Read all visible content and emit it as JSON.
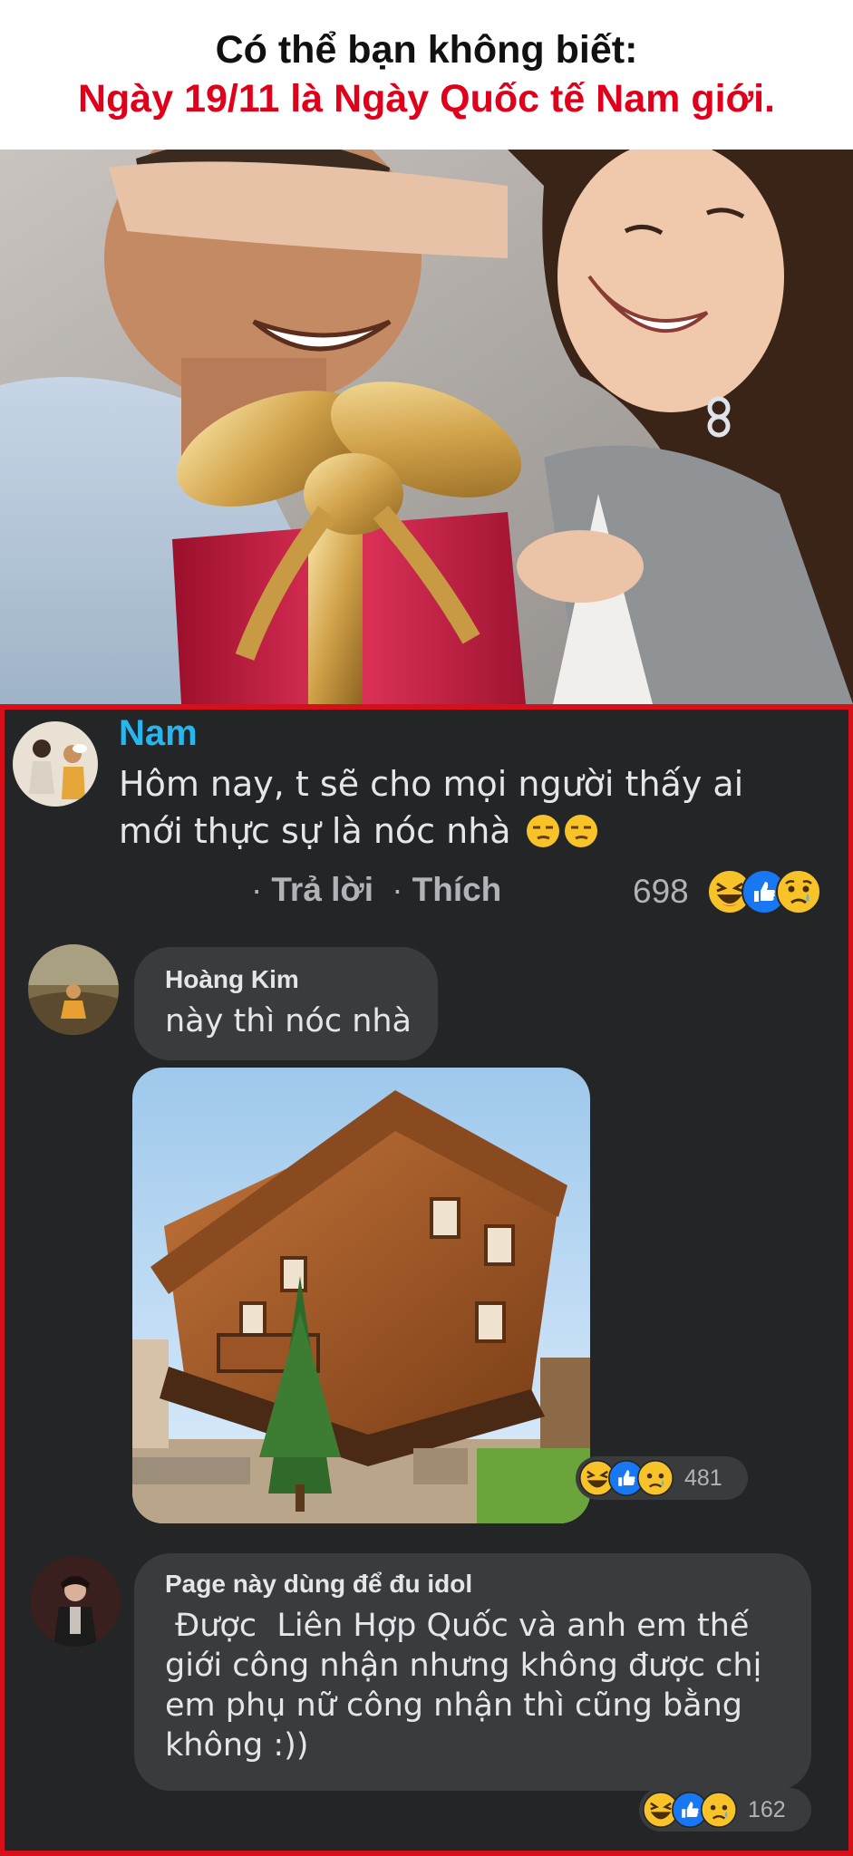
{
  "header": {
    "line1": "Có thể bạn không biết:",
    "line2": "Ngày 19/11 là Ngày Quốc tế Nam giới."
  },
  "hero": {
    "image": "photo-woman-covering-mans-eyes-with-gift"
  },
  "comments": [
    {
      "author": "Nam",
      "text_line1": "Hôm nay, t sẽ cho mọi người thấy ai",
      "text_line2": "mới thực sự là nóc nhà",
      "emojis": [
        "unamused-face",
        "unamused-face"
      ],
      "actions": [
        "Trả lời",
        "Thích"
      ],
      "reaction_count": "698",
      "reactions": [
        "haha",
        "like",
        "sad"
      ]
    },
    {
      "author": "Hoàng Kim",
      "text": "này thì nóc nhà",
      "image": "photo-upside-down-house",
      "reaction_count": "481",
      "reactions": [
        "haha",
        "like",
        "sad"
      ]
    },
    {
      "author": "Page này dùng để đu idol",
      "text_lines": [
        " Được  Liên Hợp Quốc và anh em thế",
        "giới công nhận nhưng không được chị",
        "em phụ nữ công nhận thì cũng bằng",
        "không :))"
      ],
      "reaction_count": "162",
      "reactions": [
        "haha",
        "like",
        "sad"
      ]
    }
  ],
  "colors": {
    "header_red": "#e0001b",
    "panel_border": "#d60f18",
    "panel_bg": "#242526",
    "bubble_bg": "#3a3b3c",
    "name_blue": "#27b7ef",
    "text": "#e4e6eb",
    "muted": "#b0b3b8"
  }
}
